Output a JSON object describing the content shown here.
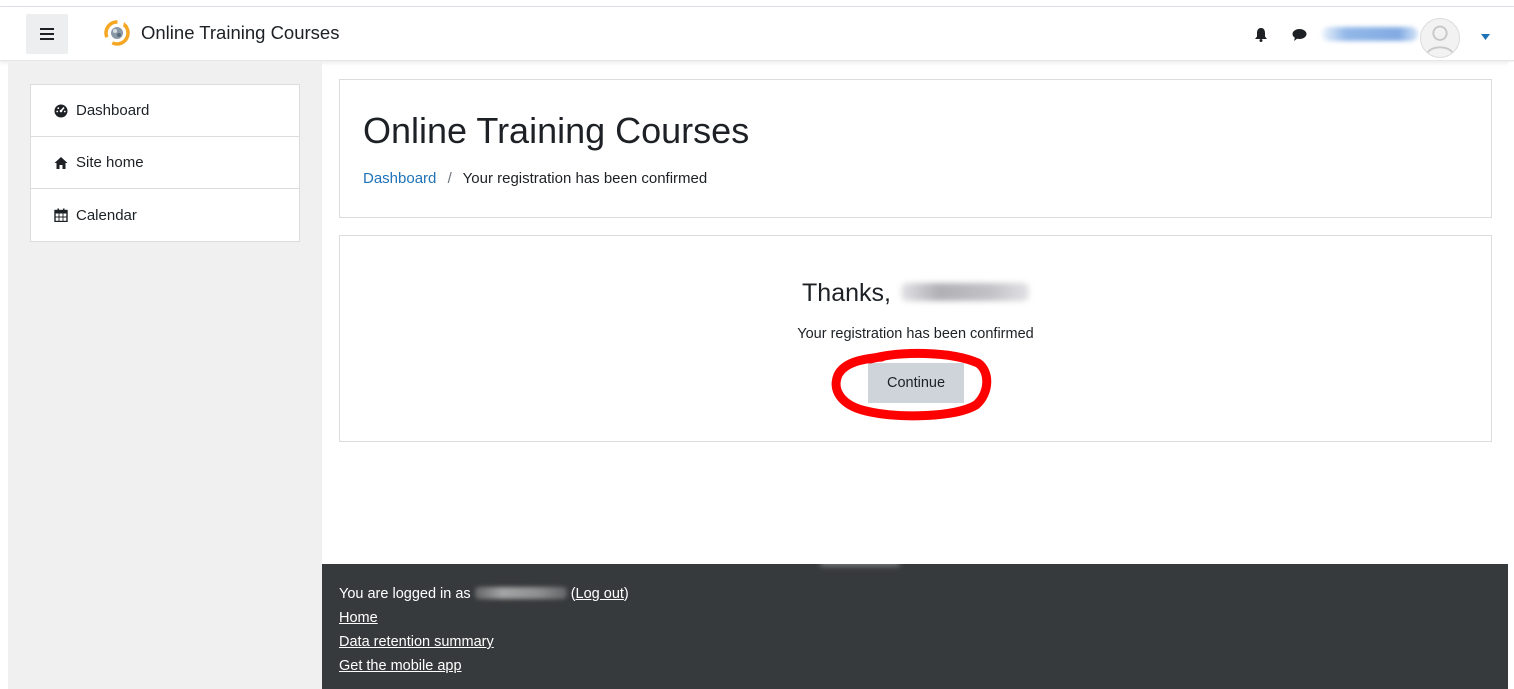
{
  "header": {
    "site_title": "Online Training Courses",
    "icons": {
      "menu": "hamburger-menu-icon",
      "logo": "site-logo-icon",
      "notifications": "bell-icon",
      "messages": "chat-icon",
      "user_menu": "chevron-down-icon"
    },
    "accent_color": "#1f73b7"
  },
  "sidebar": {
    "items": [
      {
        "label": "Dashboard",
        "icon": "tachometer-icon"
      },
      {
        "label": "Site home",
        "icon": "home-icon"
      },
      {
        "label": "Calendar",
        "icon": "calendar-icon"
      }
    ]
  },
  "page": {
    "heading": "Online Training Courses",
    "breadcrumb": {
      "link": "Dashboard",
      "separator": "/",
      "current": "Your registration has been confirmed"
    }
  },
  "confirmation": {
    "thanks_prefix": "Thanks,",
    "message": "Your registration has been confirmed",
    "continue_label": "Continue",
    "highlight_color": "#ff0000"
  },
  "footer": {
    "logged_in_prefix": "You are logged in as",
    "logout_open": "(",
    "logout_label": "Log out",
    "logout_close": ")",
    "links": [
      "Home",
      "Data retention summary",
      "Get the mobile app"
    ]
  }
}
